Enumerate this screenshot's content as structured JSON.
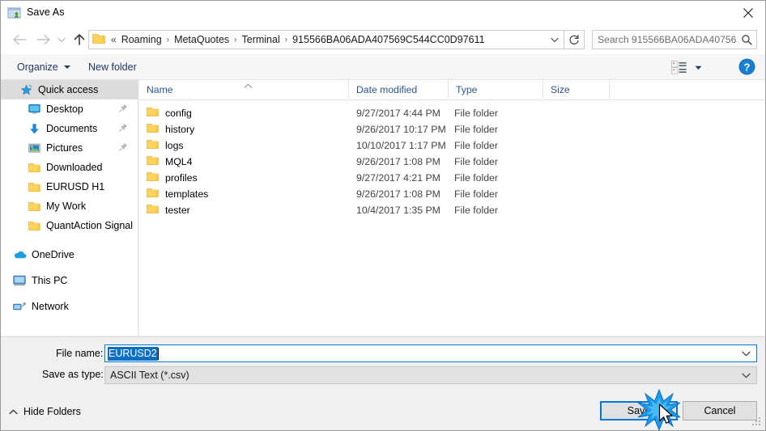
{
  "window": {
    "title": "Save As",
    "app_icon": "save-as-window-icon",
    "close_label": "✕"
  },
  "nav": {
    "back_icon": "arrow-left-icon",
    "forward_icon": "arrow-right-icon",
    "recent_icon": "chevron-down-icon",
    "up_icon": "arrow-up-icon",
    "breadcrumb_overflow": "«",
    "breadcrumbs": [
      "Roaming",
      "MetaQuotes",
      "Terminal",
      "915566BA06ADA407569C544CC0D97611"
    ],
    "separator": "›",
    "dropdown_icon": "chevron-down-icon",
    "refresh_icon": "refresh-icon"
  },
  "search": {
    "placeholder": "Search 915566BA06ADA40756...",
    "icon": "search-icon"
  },
  "toolbar": {
    "organize_label": "Organize",
    "new_folder_label": "New folder",
    "view_icon": "view-list-icon",
    "view_caret_icon": "chevron-down-icon",
    "help_icon": "help-question-icon"
  },
  "sidebar": {
    "items": [
      {
        "label": "Quick access",
        "icon": "star-icon",
        "level": 0,
        "selected": true,
        "pinned": false
      },
      {
        "label": "Desktop",
        "icon": "desktop-icon",
        "level": 1,
        "selected": false,
        "pinned": true
      },
      {
        "label": "Documents",
        "icon": "download-arrow-icon",
        "level": 1,
        "selected": false,
        "pinned": true
      },
      {
        "label": "Pictures",
        "icon": "pictures-icon",
        "level": 1,
        "selected": false,
        "pinned": true
      },
      {
        "label": "Downloaded",
        "icon": "folder-icon",
        "level": 1,
        "selected": false,
        "pinned": false
      },
      {
        "label": "EURUSD H1",
        "icon": "folder-icon",
        "level": 1,
        "selected": false,
        "pinned": false
      },
      {
        "label": "My Work",
        "icon": "folder-icon",
        "level": 1,
        "selected": false,
        "pinned": false
      },
      {
        "label": "QuantAction Signal",
        "icon": "folder-icon",
        "level": 1,
        "selected": false,
        "pinned": false
      },
      {
        "label": "OneDrive",
        "icon": "onedrive-cloud-icon",
        "level": 0,
        "selected": false,
        "pinned": false
      },
      {
        "label": "This PC",
        "icon": "this-pc-icon",
        "level": 0,
        "selected": false,
        "pinned": false
      },
      {
        "label": "Network",
        "icon": "network-icon",
        "level": 0,
        "selected": false,
        "pinned": false
      }
    ]
  },
  "filelist": {
    "columns": [
      {
        "label": "Name",
        "sorted": "asc"
      },
      {
        "label": "Date modified",
        "sorted": ""
      },
      {
        "label": "Type",
        "sorted": ""
      },
      {
        "label": "Size",
        "sorted": ""
      }
    ],
    "rows": [
      {
        "name": "config",
        "date": "9/27/2017 4:44 PM",
        "type": "File folder",
        "size": ""
      },
      {
        "name": "history",
        "date": "9/26/2017 10:17 PM",
        "type": "File folder",
        "size": ""
      },
      {
        "name": "logs",
        "date": "10/10/2017 1:17 PM",
        "type": "File folder",
        "size": ""
      },
      {
        "name": "MQL4",
        "date": "9/26/2017 1:08 PM",
        "type": "File folder",
        "size": ""
      },
      {
        "name": "profiles",
        "date": "9/27/2017 4:21 PM",
        "type": "File folder",
        "size": ""
      },
      {
        "name": "templates",
        "date": "9/26/2017 1:08 PM",
        "type": "File folder",
        "size": ""
      },
      {
        "name": "tester",
        "date": "10/4/2017 1:35 PM",
        "type": "File folder",
        "size": ""
      }
    ]
  },
  "form": {
    "filename_label": "File name:",
    "filename_value": "EURUSD2",
    "filetype_label": "Save as type:",
    "filetype_value": "ASCII Text (*.csv)",
    "combo_arrow_icon": "chevron-down-icon"
  },
  "footer": {
    "hide_folders_label": "Hide Folders",
    "hide_folders_icon": "chevron-up-icon",
    "save_label": "Save",
    "cancel_label": "Cancel",
    "resize_grip_icon": "resize-grip-icon",
    "cursor_icon": "mouse-pointer-icon",
    "click_effect_icon": "click-burst-icon"
  },
  "colors": {
    "accent": "#0078d7",
    "selection": "#0b6fc4",
    "toolbar_text": "#1f3864",
    "column_header_text": "#2f5496",
    "folder_yellow": "#ffd25e",
    "window_bg": "#f0f0f0"
  }
}
